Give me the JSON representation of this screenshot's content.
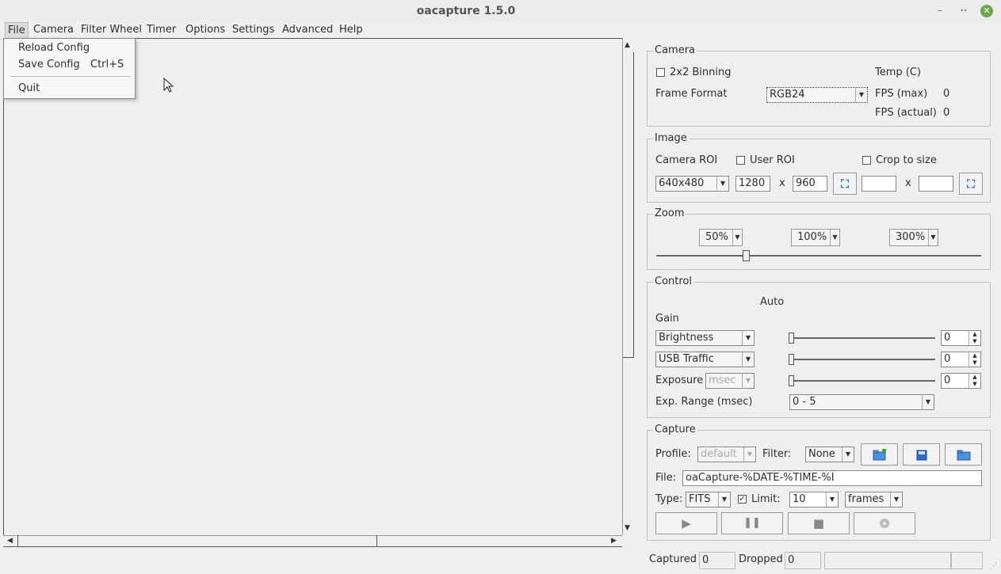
{
  "window": {
    "title": "oacapture 1.5.0",
    "minimize": "–",
    "restore": "••",
    "close": "✕"
  },
  "menubar": {
    "file": "File",
    "camera": "Camera",
    "filter_wheel": "Filter Wheel",
    "timer": "Timer",
    "options": "Options",
    "settings": "Settings",
    "advanced": "Advanced",
    "help": "Help"
  },
  "file_menu": {
    "reload_config": "Reload Config",
    "save_config": "Save Config",
    "save_shortcut": "Ctrl+S",
    "quit": "Quit"
  },
  "camera": {
    "title": "Camera",
    "binning_label": "2x2 Binning",
    "temp_label": "Temp (C)",
    "frame_format_label": "Frame Format",
    "frame_format_value": "RGB24",
    "fps_max_label": "FPS (max)",
    "fps_max_value": "0",
    "fps_actual_label": "FPS (actual)",
    "fps_actual_value": "0"
  },
  "image": {
    "title": "Image",
    "camera_roi_label": "Camera ROI",
    "user_roi_label": "User ROI",
    "crop_label": "Crop to size",
    "roi_value": "640x480",
    "width_value": "1280",
    "x_label": "x",
    "height_value": "960",
    "crop_width": "",
    "crop_height": ""
  },
  "zoom": {
    "title": "Zoom",
    "btn_50": "50%",
    "btn_100": "100%",
    "btn_300": "300%"
  },
  "control": {
    "title": "Control",
    "auto_label": "Auto",
    "gain_label": "Gain",
    "brightness_label": "Brightness",
    "brightness_value": "0",
    "usb_traffic_label": "USB Traffic",
    "usb_traffic_value": "0",
    "exposure_label": "Exposure",
    "exposure_unit": "msec",
    "exposure_value": "0",
    "exp_range_label": "Exp. Range (msec)",
    "exp_range_value": "0 - 5"
  },
  "capture": {
    "title": "Capture",
    "profile_label": "Profile:",
    "profile_value": "default",
    "filter_label": "Filter:",
    "filter_value": "None",
    "file_label": "File:",
    "file_value": "oaCapture-%DATE-%TIME-%I",
    "type_label": "Type:",
    "type_value": "FITS",
    "limit_label": "Limit:",
    "limit_value": "10",
    "limit_unit": "frames"
  },
  "status": {
    "captured_label": "Captured",
    "captured_value": "0",
    "dropped_label": "Dropped",
    "dropped_value": "0"
  }
}
